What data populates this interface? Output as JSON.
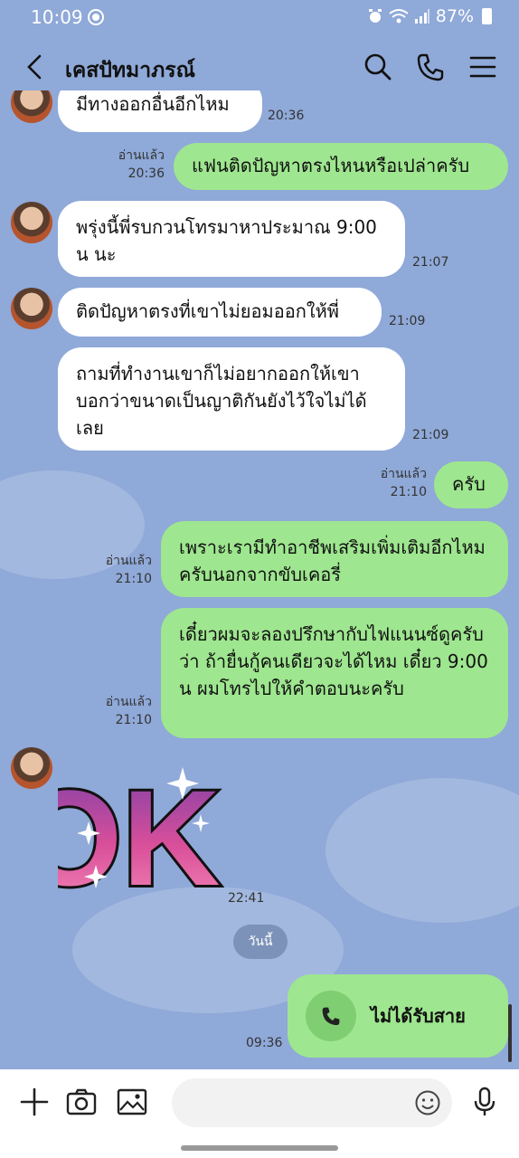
{
  "status": {
    "time": "10:09",
    "battery": "87%"
  },
  "header": {
    "title": "เคสปัทมาภรณ์"
  },
  "messages": [
    {
      "text": "มีทางออกอื่นอีกไหม",
      "time": "20:36"
    },
    {
      "text": "แฟนติดปัญหาตรงไหนหรือเปล่าครับ",
      "read": "อ่านแล้ว",
      "time": "20:36"
    },
    {
      "text": "พรุ่งนี้พี่รบกวนโทรมาหาประมาณ 9:00 น นะ",
      "time": "21:07"
    },
    {
      "text": "ติดปัญหาตรงที่เขาไม่ยอมออกให้พี่",
      "time": "21:09"
    },
    {
      "text": "ถามที่ทำงานเขาก็ไม่อยากออกให้เขา บอกว่าขนาดเป็นญาติกันยังไว้ใจไม่ได้เลย",
      "time": "21:09"
    },
    {
      "text": "ครับ",
      "read": "อ่านแล้ว",
      "time": "21:10"
    },
    {
      "text": "เพราะเรามีทำอาชีพเสริมเพิ่มเติมอีกไหมครับนอกจากขับเคอรี่",
      "read": "อ่านแล้ว",
      "time": "21:10"
    },
    {
      "text": "เดี๋ยวผมจะลองปรึกษากับไฟแนนซ์ดูครับว่า ถ้ายื่นกู้คนเดียวจะได้ไหม เดี๋ยว 9:00 น ผมโทรไปให้คำตอบนะครับ",
      "read": "อ่านแล้ว",
      "time": "21:10"
    }
  ],
  "sticker": {
    "text": "OK!",
    "time": "22:41"
  },
  "date_divider": "วันนี้",
  "call": {
    "label": "ไม่ได้รับสาย",
    "time": "09:36"
  },
  "input": {
    "placeholder": ""
  }
}
